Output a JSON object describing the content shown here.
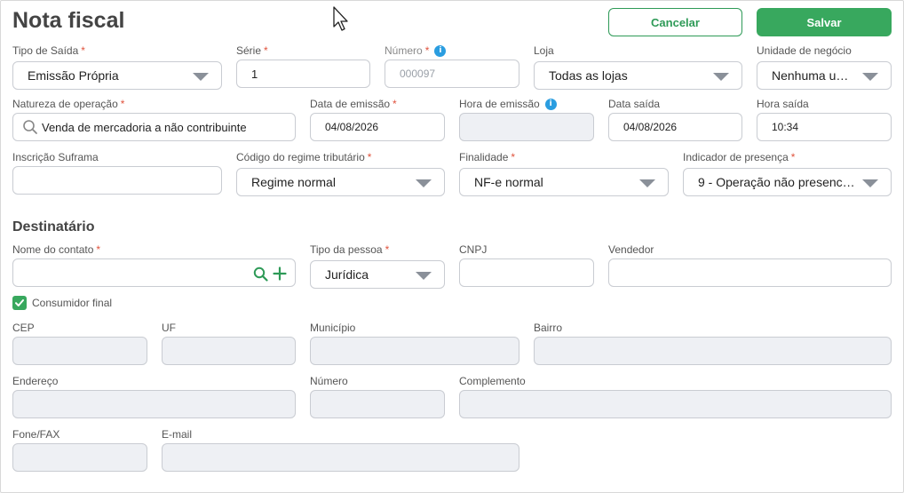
{
  "page": {
    "title": "Nota fiscal"
  },
  "header": {
    "cancel_label": "Cancelar",
    "save_label": "Salvar"
  },
  "colors": {
    "accent": "#38a85e",
    "info": "#2a9de0",
    "required": "#e0533d"
  },
  "fields": {
    "tipo_saida": {
      "label": "Tipo de Saída",
      "required": "*",
      "value": "Emissão Própria"
    },
    "serie": {
      "label": "Série",
      "required": "*",
      "value": "1"
    },
    "numero": {
      "label": "Número",
      "required": "*",
      "placeholder": "000097"
    },
    "loja": {
      "label": "Loja",
      "value": "Todas as lojas"
    },
    "unidade_negocio": {
      "label": "Unidade de negócio",
      "value": "Nenhuma unid…"
    },
    "natureza_operacao": {
      "label": "Natureza de operação",
      "required": "*",
      "value": "Venda de mercadoria a não contribuinte"
    },
    "data_emissao": {
      "label": "Data de emissão",
      "required": "*",
      "value": "04/08/2026"
    },
    "hora_emissao": {
      "label": "Hora de emissão",
      "value": ""
    },
    "data_saida": {
      "label": "Data saída",
      "value": "04/08/2026"
    },
    "hora_saida": {
      "label": "Hora saída",
      "value": "10:34"
    },
    "inscricao_suframa": {
      "label": "Inscrição Suframa",
      "value": ""
    },
    "codigo_regime": {
      "label": "Código do regime tributário",
      "required": "*",
      "value": "Regime normal"
    },
    "finalidade": {
      "label": "Finalidade",
      "required": "*",
      "value": "NF-e normal"
    },
    "indicador_presenca": {
      "label": "Indicador de presença",
      "required": "*",
      "value": "9 - Operação não presencial, …"
    }
  },
  "destinatario": {
    "section_title": "Destinatário",
    "nome_contato": {
      "label": "Nome do contato",
      "required": "*",
      "value": ""
    },
    "tipo_pessoa": {
      "label": "Tipo da pessoa",
      "required": "*",
      "value": "Jurídica"
    },
    "cnpj": {
      "label": "CNPJ",
      "value": ""
    },
    "vendedor": {
      "label": "Vendedor",
      "value": ""
    },
    "consumidor_final": {
      "label": "Consumidor final",
      "checked": true
    },
    "cep": {
      "label": "CEP"
    },
    "uf": {
      "label": "UF"
    },
    "municipio": {
      "label": "Município"
    },
    "bairro": {
      "label": "Bairro"
    },
    "endereco": {
      "label": "Endereço"
    },
    "numero": {
      "label": "Número"
    },
    "complemento": {
      "label": "Complemento"
    },
    "fone_fax": {
      "label": "Fone/FAX"
    },
    "email": {
      "label": "E-mail"
    }
  },
  "icons": {
    "info": "info-icon",
    "search": "search-icon",
    "add": "plus-icon",
    "check": "check-icon",
    "dropdown": "chevron-down-icon",
    "cursor": "mouse-cursor-icon"
  }
}
